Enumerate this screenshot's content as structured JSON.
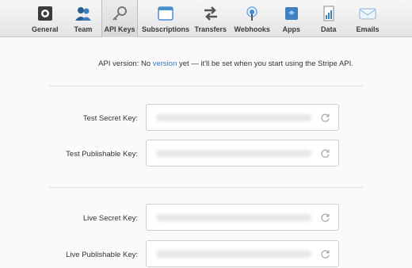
{
  "tabs": [
    {
      "label": "General",
      "icon": "general-icon"
    },
    {
      "label": "Team",
      "icon": "team-icon"
    },
    {
      "label": "API Keys",
      "icon": "key-icon"
    },
    {
      "label": "Subscriptions",
      "icon": "subscriptions-icon"
    },
    {
      "label": "Transfers",
      "icon": "transfers-icon"
    },
    {
      "label": "Webhooks",
      "icon": "webhooks-icon"
    },
    {
      "label": "Apps",
      "icon": "apps-icon"
    },
    {
      "label": "Data",
      "icon": "data-icon"
    },
    {
      "label": "Emails",
      "icon": "emails-icon"
    }
  ],
  "active_tab": "API Keys",
  "api_version": {
    "prefix": "API version: No ",
    "link": "version",
    "suffix": " yet — it'll be set when you start using the Stripe API."
  },
  "keys": {
    "test_secret_label": "Test Secret Key:",
    "test_publishable_label": "Test Publishable Key:",
    "live_secret_label": "Live Secret Key:",
    "live_publishable_label": "Live Publishable Key:"
  },
  "colors": {
    "link": "#2f79c3",
    "tab_bar": "#e4e4e4"
  }
}
